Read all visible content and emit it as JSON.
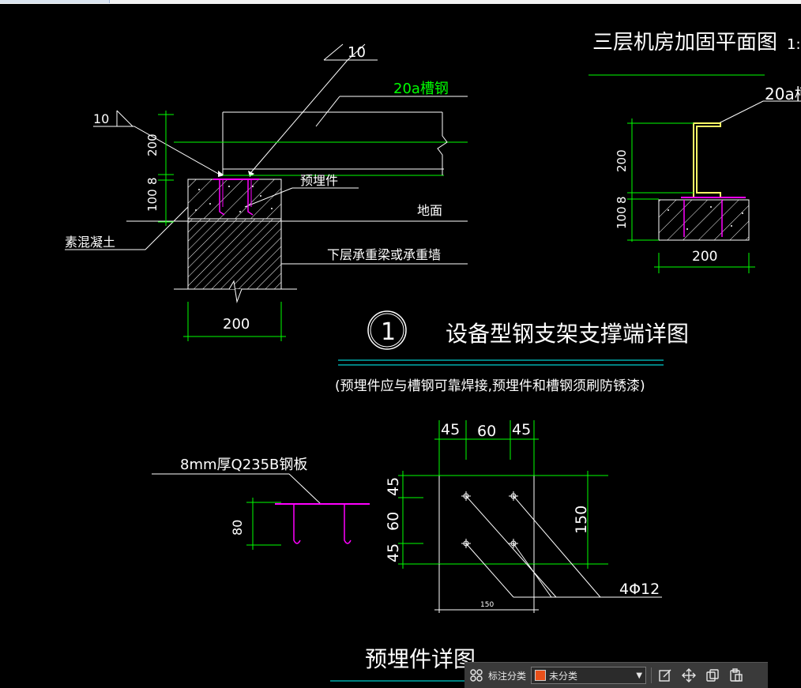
{
  "drawing": {
    "plan_title": "三层机房加固平面图",
    "plan_scale_fragment": "1:",
    "label_channel_right": "20a槽",
    "label_10_top": "10",
    "label_10_left": "10",
    "label_channel_steel": "20a槽钢",
    "label_embedded": "预埋件",
    "label_ground": "地面",
    "label_concrete": "素混凝土",
    "label_wall": "下层承重梁或承重墙",
    "dim_200_left_v": "200",
    "dim_100_left": "100",
    "dim_8_left": "8",
    "dim_200_bottom": "200",
    "dim_200_right_v": "200",
    "dim_100_right": "100",
    "dim_8_right": "8",
    "dim_200_right_bottom": "200",
    "detail_number": "1",
    "detail_title": "设备型钢支架支撑端详图",
    "note": "(预埋件应与槽钢可靠焊接,预埋件和槽钢须刷防锈漆)",
    "plate_label": "8mm厚Q235B钢板",
    "dim_80": "80",
    "dim_45_a": "45",
    "dim_60_h": "60",
    "dim_45_b": "45",
    "dim_45_v1": "45",
    "dim_60_v": "60",
    "dim_45_v2": "45",
    "dim_150_v": "150",
    "dim_150_small": "150",
    "rebar_label": "4Φ12",
    "embedded_title": "预埋件详图"
  },
  "toolbar": {
    "category_label": "标注分类",
    "category_value": "未分类",
    "swatch_color": "#e8501a"
  },
  "colors": {
    "background": "#000000",
    "line_white": "#ffffff",
    "dimension_green": "#00ff00",
    "embedded_magenta": "#ff00ff",
    "channel_yellow": "#ffff66",
    "cyan_rule": "#00ffff"
  }
}
